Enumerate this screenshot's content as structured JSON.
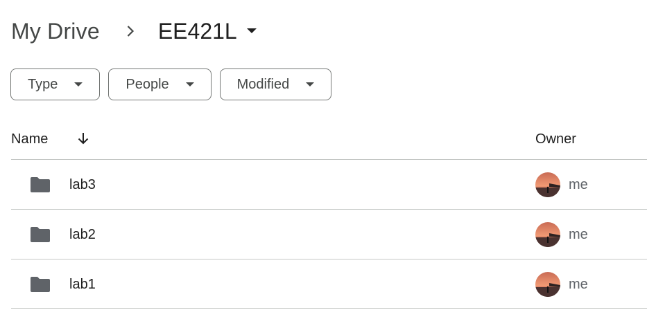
{
  "breadcrumb": {
    "root_label": "My Drive",
    "current_label": "EE421L",
    "separator_icon": "chevron-right-icon",
    "caret_icon": "caret-down-icon"
  },
  "filters": [
    {
      "label": "Type",
      "icon": "caret-down-icon"
    },
    {
      "label": "People",
      "icon": "caret-down-icon"
    },
    {
      "label": "Modified",
      "icon": "caret-down-icon"
    }
  ],
  "table": {
    "columns": {
      "name": "Name",
      "owner": "Owner"
    },
    "sort_icon": "arrow-down-icon",
    "rows": [
      {
        "name": "lab3",
        "owner": "me",
        "icon": "folder-icon"
      },
      {
        "name": "lab2",
        "owner": "me",
        "icon": "folder-icon"
      },
      {
        "name": "lab1",
        "owner": "me",
        "icon": "folder-icon"
      }
    ]
  },
  "colors": {
    "text_primary": "#1f1f1f",
    "text_secondary": "#444746",
    "folder": "#5f6368",
    "divider": "#c4c7c5",
    "chip_border": "#747775"
  }
}
